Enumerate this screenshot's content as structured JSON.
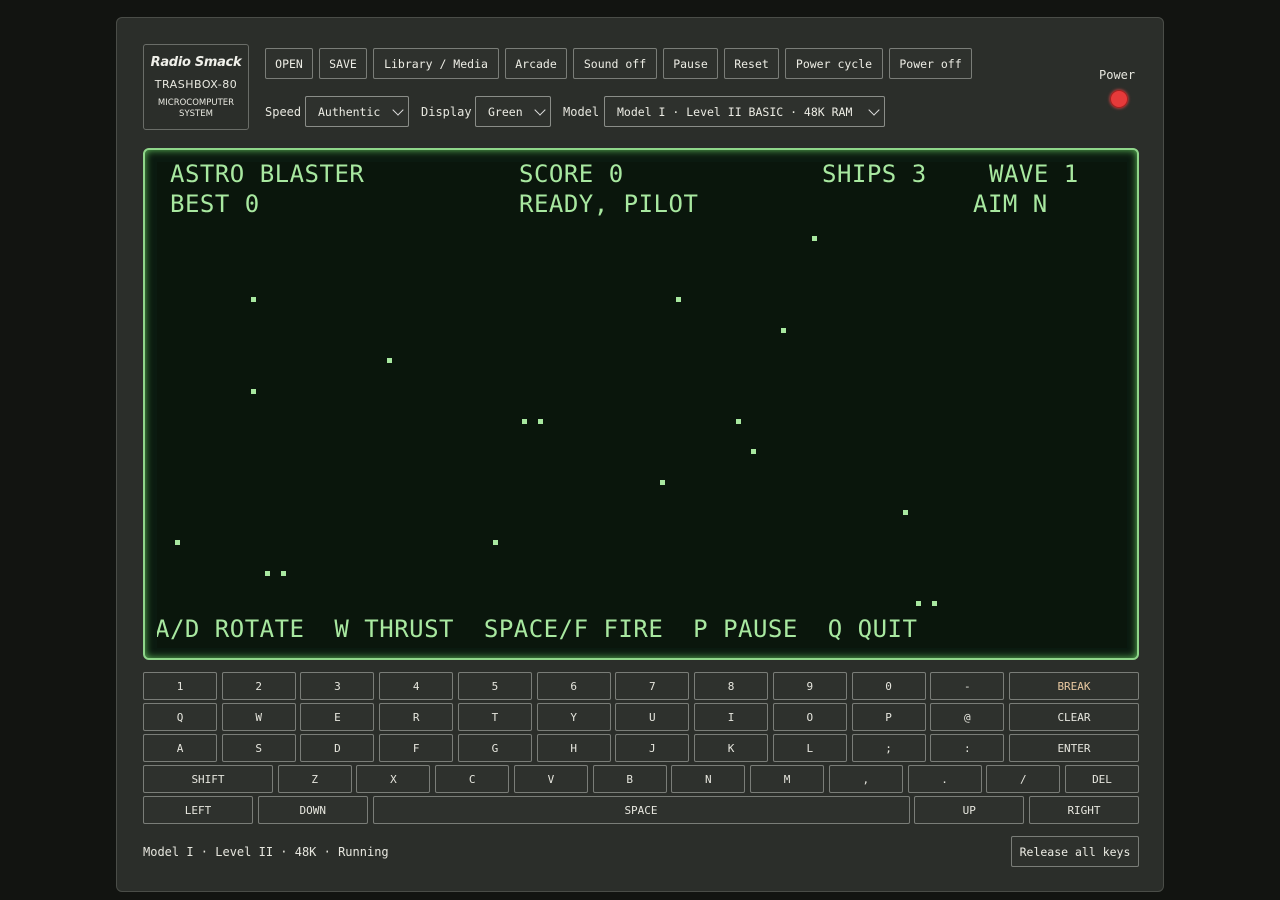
{
  "logo": {
    "brand": "Radio Smack",
    "model": "TRASHBOX-80",
    "system_line1": "MICROCOMPUTER",
    "system_line2": "SYSTEM"
  },
  "toolbar": {
    "open": "OPEN",
    "save": "SAVE",
    "library": "Library / Media",
    "arcade": "Arcade",
    "sound": "Sound off",
    "pause": "Pause",
    "reset": "Reset",
    "power_cycle": "Power cycle",
    "power_off": "Power off"
  },
  "controls": {
    "speed_label": "Speed",
    "speed_value": "Authentic",
    "display_label": "Display",
    "display_value": "Green",
    "model_label": "Model",
    "model_value": "Model I · Level II BASIC · 48K RAM"
  },
  "power": {
    "label": "Power",
    "led_color": "#e63a3a"
  },
  "screen": {
    "title": "ASTRO BLASTER",
    "score": "SCORE 0",
    "ships": "SHIPS 3",
    "wave": "WAVE 1",
    "best": "BEST 0",
    "message": "READY, PILOT",
    "aim": "AIM N",
    "help": "A/D ROTATE  W THRUST  SPACE/F FIRE  P PAUSE  Q QUIT",
    "phosphor_color": "#a8e8a0"
  },
  "keyboard": {
    "row1": [
      "1",
      "2",
      "3",
      "4",
      "5",
      "6",
      "7",
      "8",
      "9",
      "0",
      "-",
      "BREAK"
    ],
    "row2": [
      "Q",
      "W",
      "E",
      "R",
      "T",
      "Y",
      "U",
      "I",
      "O",
      "P",
      "@",
      "CLEAR"
    ],
    "row3": [
      "A",
      "S",
      "D",
      "F",
      "G",
      "H",
      "J",
      "K",
      "L",
      ";",
      ":",
      "ENTER"
    ],
    "row4": [
      "SHIFT",
      "Z",
      "X",
      "C",
      "V",
      "B",
      "N",
      "M",
      ",",
      ".",
      "/",
      "DEL"
    ],
    "row5": [
      "LEFT",
      "DOWN",
      "SPACE",
      "UP",
      "RIGHT"
    ]
  },
  "status": "Model I · Level II · 48K · Running",
  "release_keys": "Release all keys"
}
